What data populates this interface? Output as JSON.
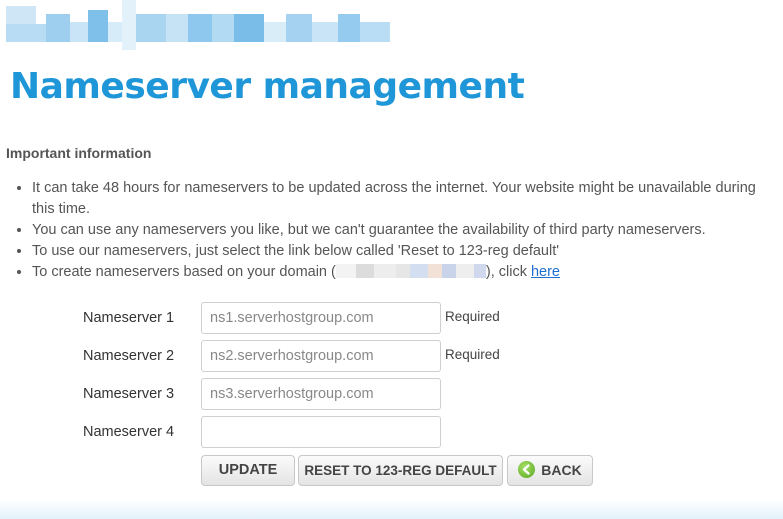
{
  "page": {
    "title": "Nameserver management"
  },
  "important": {
    "heading": "Important information",
    "bullets": [
      "It can take 48 hours for nameservers to be updated across the internet. Your website might be unavailable during this time.",
      "You can use any nameservers you like, but we can't guarantee the availability of third party nameservers.",
      "To use our nameservers, just select the link below called 'Reset to 123-reg default'"
    ],
    "domain_bullet_prefix": "To create nameservers based on your domain (",
    "domain_bullet_suffix": "), click ",
    "domain_bullet_link": "here"
  },
  "nameservers": [
    {
      "label": "Nameserver 1",
      "value": "",
      "placeholder": "ns1.serverhostgroup.com",
      "note": "Required"
    },
    {
      "label": "Nameserver 2",
      "value": "",
      "placeholder": "ns2.serverhostgroup.com",
      "note": "Required"
    },
    {
      "label": "Nameserver 3",
      "value": "",
      "placeholder": "ns3.serverhostgroup.com",
      "note": ""
    },
    {
      "label": "Nameserver 4",
      "value": "",
      "placeholder": "",
      "note": ""
    }
  ],
  "buttons": {
    "update": "UPDATE",
    "reset": "RESET TO 123-REG DEFAULT",
    "back": "BACK"
  },
  "icons": {
    "back": "back-arrow-icon"
  },
  "colors": {
    "title": "#1e96d8",
    "link": "#1e6fd0",
    "back_icon": "#5aa624"
  }
}
